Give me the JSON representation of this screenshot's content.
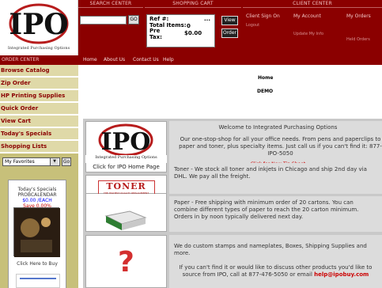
{
  "logo": {
    "letters": "IPO",
    "caption": "Integrated Purchasing Options"
  },
  "header": {
    "search_center": "SEARCH CENTER",
    "shopping_cart": "SHOPPING CART",
    "client_center": "CLIENT CENTER",
    "go": "GO"
  },
  "cart": {
    "ref_label": "Ref #:",
    "ref_value": "...",
    "total_items_label": "Total Items:",
    "total_items_value": "0",
    "pre_label": "Pre",
    "pre_value": "$0.00",
    "tax_label": "Tax:",
    "view_button": "View",
    "order_button": "Order"
  },
  "client": {
    "sign_on": "Client Sign On",
    "logout": "Logout",
    "my_account": "My Account",
    "update_info": "Update My Info",
    "my_orders": "My Orders",
    "held_orders": "Held Orders"
  },
  "order_center": "ORDER CENTER",
  "topnav": [
    "Home",
    "About Us",
    "Contact Us",
    "Help"
  ],
  "sidebar": {
    "items": [
      "Browse Catalog",
      "Zip Order",
      "HP Printing Supplies",
      "Quick Order",
      "View Cart",
      "Today's Specials",
      "Shopping Lists"
    ],
    "favorites_value": "My Favorites",
    "go": "Go",
    "special": {
      "title": "Today's Specials",
      "code": "PROBCALENDAR",
      "price": "$0.00 /EACH",
      "save": "Save 0.00%",
      "cta": "Click Here to Buy"
    }
  },
  "content": {
    "crumb": "Home",
    "demo": "DEMO",
    "welcome": "Welcome to Integrated Purchasing Options",
    "intro": "Our one-stop-shop for all your office needs. From pens and paperclips to paper and toner, plus specialty items. Just call us if you can't find it: 877-IPO-5050",
    "tip": "Click for New Tip Sheet",
    "home_link": "Click for IPO Home Page",
    "toner_logo": "TONER",
    "toner_tag": "THE HIGHEST QUALITY REPLACEMENT TONERS",
    "toner_text": "Toner - We stock all toner and inkjets in Chicago and ship 2nd day via DHL. We pay all the freight.",
    "paper_text": "Paper - Free shipping with minimum order of 20 cartons. You can combine different types of paper to reach the 20 carton minimum. Orders in by noon typically delivered next day.",
    "custom_text": "We do custom stamps and nameplates, Boxes, Shipping Supplies and more.",
    "find_text": "If you can't find it or would like to discuss other products you'd like to source from IPO, call at 877-476-5050 or email",
    "email": "help@ipobuy.com"
  },
  "colors": {
    "brand": "#8b0000",
    "sidebar": "#c7c07a",
    "link": "#cc0000"
  }
}
